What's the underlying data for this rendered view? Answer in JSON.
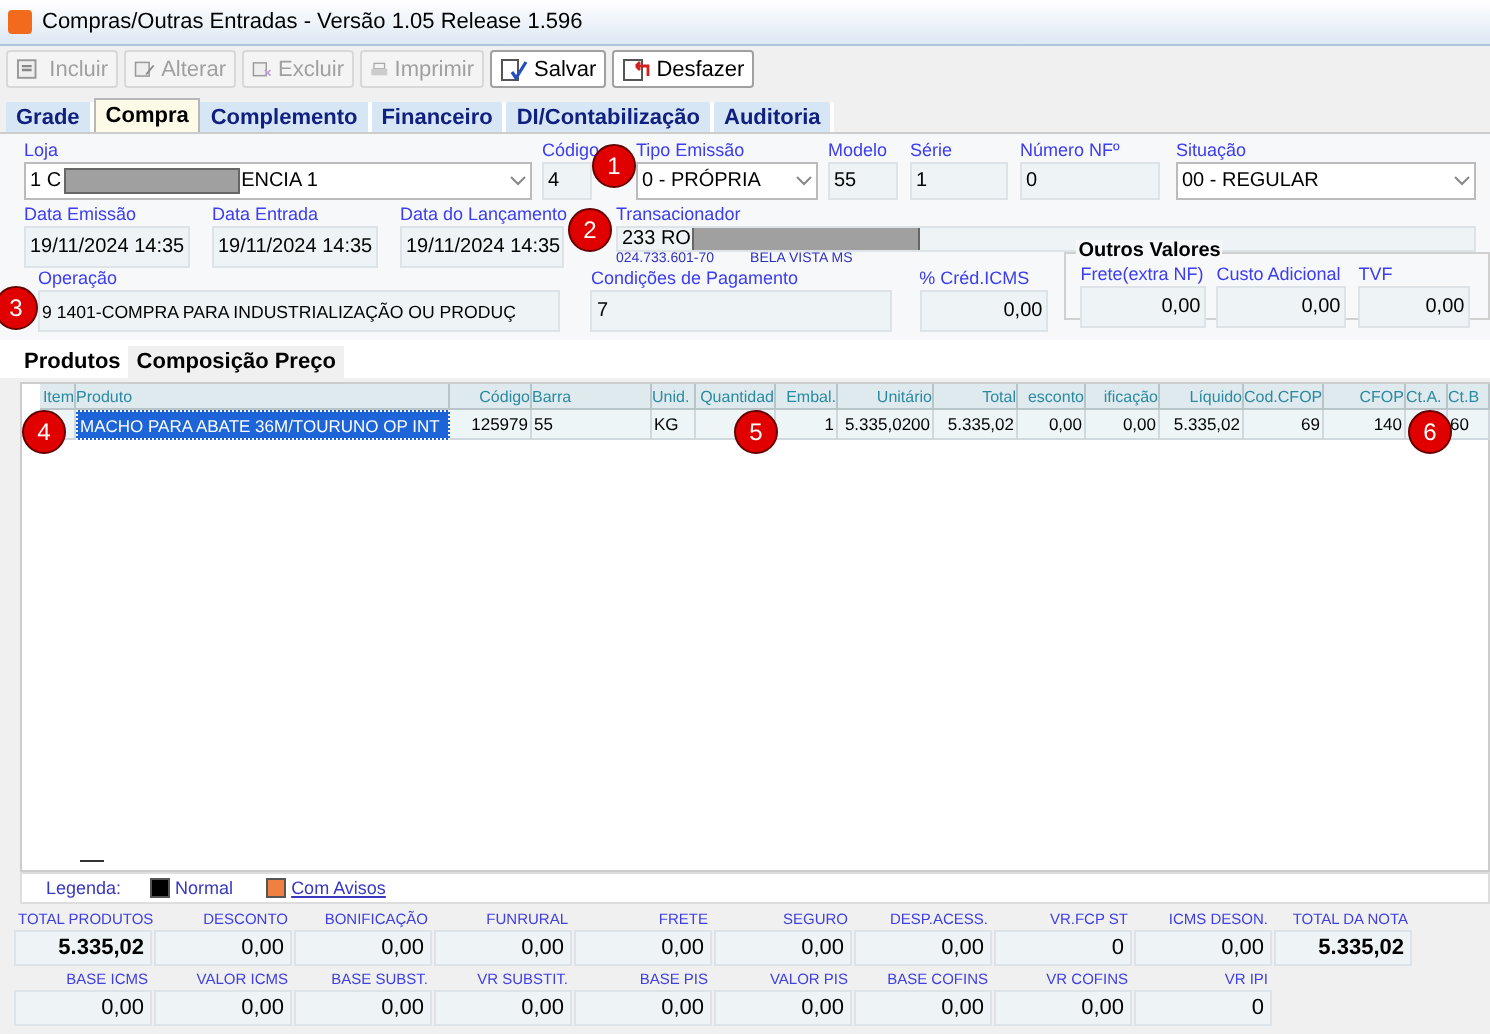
{
  "window": {
    "title": "Compras/Outras Entradas - Versão 1.05 Release 1.596"
  },
  "toolbar": [
    {
      "label": "Incluir",
      "kind": "new",
      "disabled": true
    },
    {
      "label": "Alterar",
      "kind": "edit",
      "disabled": true
    },
    {
      "label": "Excluir",
      "kind": "delete",
      "disabled": true
    },
    {
      "label": "Imprimir",
      "kind": "print",
      "disabled": true
    },
    {
      "label": "Salvar",
      "kind": "save",
      "disabled": false
    },
    {
      "label": "Desfazer",
      "kind": "undo",
      "disabled": false
    }
  ],
  "tabs": [
    {
      "label": "Grade",
      "selected": false
    },
    {
      "label": "Compra",
      "selected": true
    },
    {
      "label": "Complemento",
      "selected": false
    },
    {
      "label": "Financeiro",
      "selected": false
    },
    {
      "label": "DI/Contabilização",
      "selected": false
    },
    {
      "label": "Auditoria",
      "selected": false
    }
  ],
  "form": {
    "row_1": [
      {
        "label": "Loja",
        "kind": "redacted-dropdown",
        "value": "1 C",
        "value_after": "ENCIA 1"
      },
      {
        "label": "Código",
        "kind": "number",
        "value": "4"
      },
      {
        "label": "Tipo Emissão",
        "kind": "dropdown",
        "value": "0 - PRÓPRIA"
      },
      {
        "label": "Modelo",
        "kind": "text",
        "value": "55"
      },
      {
        "label": "Série",
        "kind": "text",
        "value": "1"
      },
      {
        "label": "Número NFº",
        "kind": "number",
        "value": "0"
      },
      {
        "label": "Situação",
        "kind": "dropdown",
        "value": "00 - REGULAR"
      }
    ],
    "row_2": [
      {
        "label": "Data Emissão",
        "kind": "text",
        "value": "19/11/2024 14:35"
      },
      {
        "label": "Data Entrada",
        "kind": "text",
        "value": "19/11/2024 14:35"
      },
      {
        "label": "Data do Lançamento",
        "kind": "text",
        "value": "19/11/2024 14:35"
      },
      {
        "label": "Transacionador",
        "kind": "redacted",
        "value": "233 RO",
        "document": "024.733.601-70",
        "city": "BELA VISTA MS"
      }
    ],
    "row_3": [
      {
        "label": "Operação",
        "kind": "text",
        "value": "9 1401-COMPRA PARA INDUSTRIALIZAÇÃO OU PRODUÇ"
      },
      {
        "label": "Condições de Pagamento",
        "kind": "text",
        "value": "7"
      },
      {
        "label": "% Créd.ICMS",
        "kind": "number",
        "value": "0,00"
      }
    ],
    "other_values": {
      "title": "Outros Valores",
      "fields": [
        {
          "label": "Frete(extra NF)",
          "kind": "number",
          "value": "0,00"
        },
        {
          "label": "Custo Adicional",
          "kind": "number",
          "value": "0,00"
        },
        {
          "label": "TVF",
          "kind": "number",
          "value": "0,00"
        }
      ]
    }
  },
  "subtabs": [
    {
      "label": "Produtos",
      "selected": true
    },
    {
      "label": "Composição Preço",
      "selected": false
    }
  ],
  "table": {
    "columns": [
      {
        "label": "Item",
        "kind": "number"
      },
      {
        "label": "Produto",
        "kind": "text"
      },
      {
        "label": "Código",
        "kind": "number"
      },
      {
        "label": "Barra",
        "kind": "text"
      },
      {
        "label": "Unid.",
        "kind": "text"
      },
      {
        "label": "Quantidad",
        "kind": "number"
      },
      {
        "label": "Embal.",
        "kind": "number"
      },
      {
        "label": "Unitário",
        "kind": "number"
      },
      {
        "label": "Total",
        "kind": "number"
      },
      {
        "label": "esconto",
        "kind": "number"
      },
      {
        "label": "ificação",
        "kind": "number"
      },
      {
        "label": "Líquido",
        "kind": "number"
      },
      {
        "label": "Cod.CFOP",
        "kind": "number"
      },
      {
        "label": "CFOP",
        "kind": "number"
      },
      {
        "label": "Ct.A.",
        "kind": "text"
      },
      {
        "label": "Ct.B",
        "kind": "text"
      }
    ],
    "rows": [
      {
        "cells": [
          {
            "focused": false
          },
          {
            "text": "MACHO PARA ABATE 36M/TOURUNO OP INT",
            "focused": true
          },
          {
            "text": "125979",
            "focused": false
          },
          {
            "text": "55",
            "focused": false
          },
          {
            "text": "KG",
            "focused": false
          },
          {
            "focused": false
          },
          {
            "text": "1",
            "focused": false
          },
          {
            "text": "5.335,0200",
            "focused": false
          },
          {
            "text": "5.335,02",
            "focused": false
          },
          {
            "text": "0,00",
            "focused": false
          },
          {
            "text": "0,00",
            "focused": false
          },
          {
            "text": "5.335,02",
            "focused": false
          },
          {
            "text": "69",
            "focused": false
          },
          {
            "text": "140",
            "focused": false
          },
          {
            "focused": false
          },
          {
            "text": "60",
            "focused": false
          }
        ]
      }
    ]
  },
  "legend": {
    "label": "Legenda:",
    "items": [
      {
        "label": "Normal",
        "color": "#000000",
        "link": false
      },
      {
        "label": "Com Avisos",
        "color": "#f08040",
        "link": true
      }
    ]
  },
  "totals": [
    [
      {
        "label": "TOTAL PRODUTOS",
        "value": "5.335,02",
        "emphasis": true
      },
      {
        "label": "DESCONTO",
        "value": "0,00",
        "emphasis": false
      },
      {
        "label": "BONIFICAÇÃO",
        "value": "0,00",
        "emphasis": false
      },
      {
        "label": "FUNRURAL",
        "value": "0,00",
        "emphasis": false
      },
      {
        "label": "FRETE",
        "value": "0,00",
        "emphasis": false
      },
      {
        "label": "SEGURO",
        "value": "0,00",
        "emphasis": false
      },
      {
        "label": "DESP.ACESS.",
        "value": "0,00",
        "emphasis": false
      },
      {
        "label": "VR.FCP ST",
        "value": "0",
        "emphasis": false
      },
      {
        "label": "ICMS DESON.",
        "value": "0,00",
        "emphasis": false
      },
      {
        "label": "TOTAL DA NOTA",
        "value": "5.335,02",
        "emphasis": true
      }
    ],
    [
      {
        "label": "BASE ICMS",
        "value": "0,00",
        "emphasis": false
      },
      {
        "label": "VALOR ICMS",
        "value": "0,00",
        "emphasis": false
      },
      {
        "label": "BASE SUBST.",
        "value": "0,00",
        "emphasis": false
      },
      {
        "label": "VR SUBSTIT.",
        "value": "0,00",
        "emphasis": false
      },
      {
        "label": "BASE PIS",
        "value": "0,00",
        "emphasis": false
      },
      {
        "label": "VALOR PIS",
        "value": "0,00",
        "emphasis": false
      },
      {
        "label": "BASE COFINS",
        "value": "0,00",
        "emphasis": false
      },
      {
        "label": "VR COFINS",
        "value": "0,00",
        "emphasis": false
      },
      {
        "label": "VR IPI",
        "value": "0",
        "emphasis": false
      }
    ]
  ],
  "markers": [
    {
      "number": "1"
    },
    {
      "number": "2"
    },
    {
      "number": "3"
    },
    {
      "number": "4"
    },
    {
      "number": "5"
    },
    {
      "number": "6"
    }
  ]
}
